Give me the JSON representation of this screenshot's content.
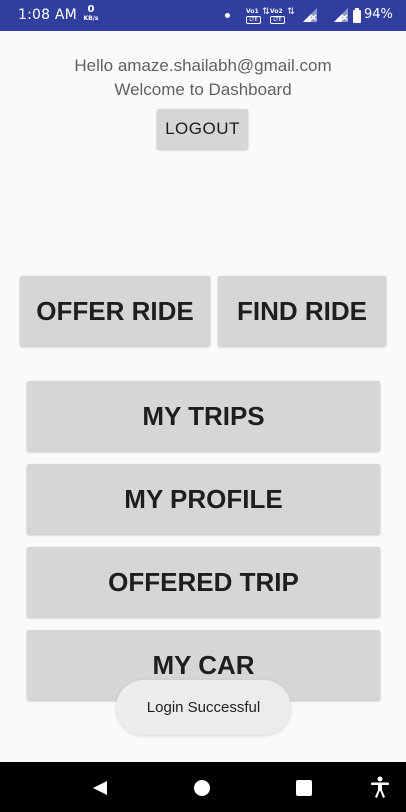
{
  "status_bar": {
    "time": "1:08 AM",
    "net_speed_value": "0",
    "net_speed_unit": "KB/s",
    "sim1_label": "Vo1",
    "sim2_label": "Vo2",
    "lte_label": "LTE",
    "battery_percent": "94%",
    "background_color": "#303f9f"
  },
  "header": {
    "greeting": "Hello amaze.shailabh@gmail.com",
    "welcome": "Welcome to Dashboard",
    "logout_label": "LOGOUT"
  },
  "actions": {
    "offer_ride_label": "OFFER RIDE",
    "find_ride_label": "FIND RIDE",
    "my_trips_label": "MY TRIPS",
    "my_profile_label": "MY PROFILE",
    "offered_trip_label": "OFFERED TRIP",
    "my_car_label": "MY CAR"
  },
  "toast": {
    "message": "Login Successful"
  },
  "nav_bar": {
    "icons": [
      "back-icon",
      "home-icon",
      "recent-apps-icon",
      "accessibility-icon"
    ]
  },
  "colors": {
    "button_gray": "#d6d6d6",
    "background": "#fafafa",
    "nav_bar": "#000000"
  }
}
